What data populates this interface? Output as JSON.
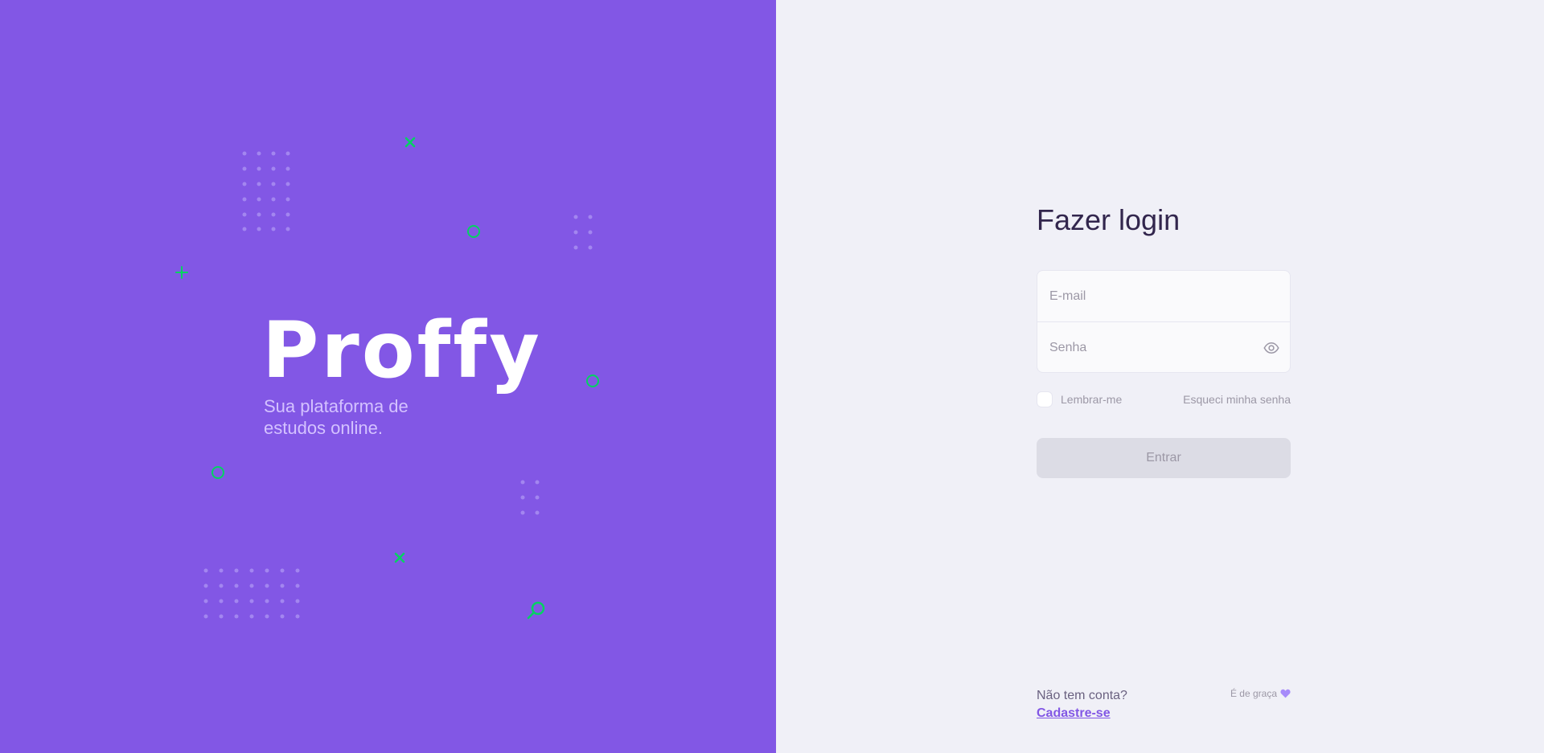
{
  "brand": {
    "logo_text": "Proffy",
    "tagline": "Sua plataforma de estudos online."
  },
  "login": {
    "title": "Fazer login",
    "email_placeholder": "E-mail",
    "password_placeholder": "Senha",
    "remember_label": "Lembrar-me",
    "forgot_label": "Esqueci minha senha",
    "submit_label": "Entrar"
  },
  "footer": {
    "no_account": "Não tem conta?",
    "signup_label": "Cadastre-se",
    "free_note": "É de graça"
  },
  "icons": {
    "password_toggle": "eye-icon",
    "free_note": "purple-heart-icon",
    "decorations": [
      "x-mark-icon",
      "circle-icon",
      "plus-icon",
      "magnifier-icon",
      "dot-grid"
    ]
  },
  "colors": {
    "brand_purple": "#8257e5",
    "accent_green": "#04d361",
    "page_background": "#f0f0f7",
    "title_text": "#32264d",
    "muted_text": "#9c98a6",
    "disabled_button": "#dcdce5"
  }
}
